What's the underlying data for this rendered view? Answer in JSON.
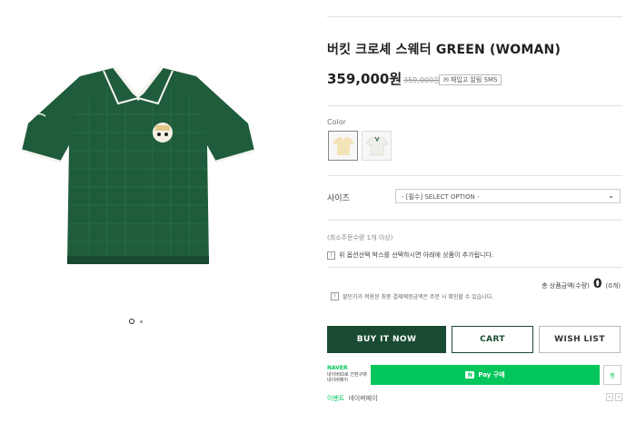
{
  "product": {
    "title": "버킷 크로셰 스웨터 GREEN (WOMAN)",
    "price": "359,000원",
    "old_price": "359,000원",
    "sms_label": "재입고 알림 SMS"
  },
  "options": {
    "color_label": "Color",
    "color_swatches": [
      "cream",
      "white"
    ],
    "size_label": "사이즈",
    "size_select_value": "- [필수] SELECT OPTION -"
  },
  "order": {
    "min_qty": "(최소주문수량 1개 이상)",
    "notice": "위 옵션선택 박스를 선택하시면 아래에 상품이 추가됩니다.",
    "total_label": "총 상품금액(수량)",
    "total_value": "0",
    "total_unit": "(0개)",
    "tax_notice": "할인가가 적용된 최종 결제예정금액은 주문 시 확인할 수 있습니다."
  },
  "buttons": {
    "buy": "BUY IT NOW",
    "cart": "CART",
    "wish": "WISH LIST"
  },
  "naver": {
    "logo": "NAVER",
    "sub1": "네이버ID로 간편구매",
    "sub2": "네이버페이",
    "pay_label": "Pay 구매",
    "zzim": "찜",
    "event_label": "이벤트",
    "event_text": "네이버페이"
  },
  "colors": {
    "brand_green": "#1a4b32",
    "naver_green": "#03c75a"
  }
}
